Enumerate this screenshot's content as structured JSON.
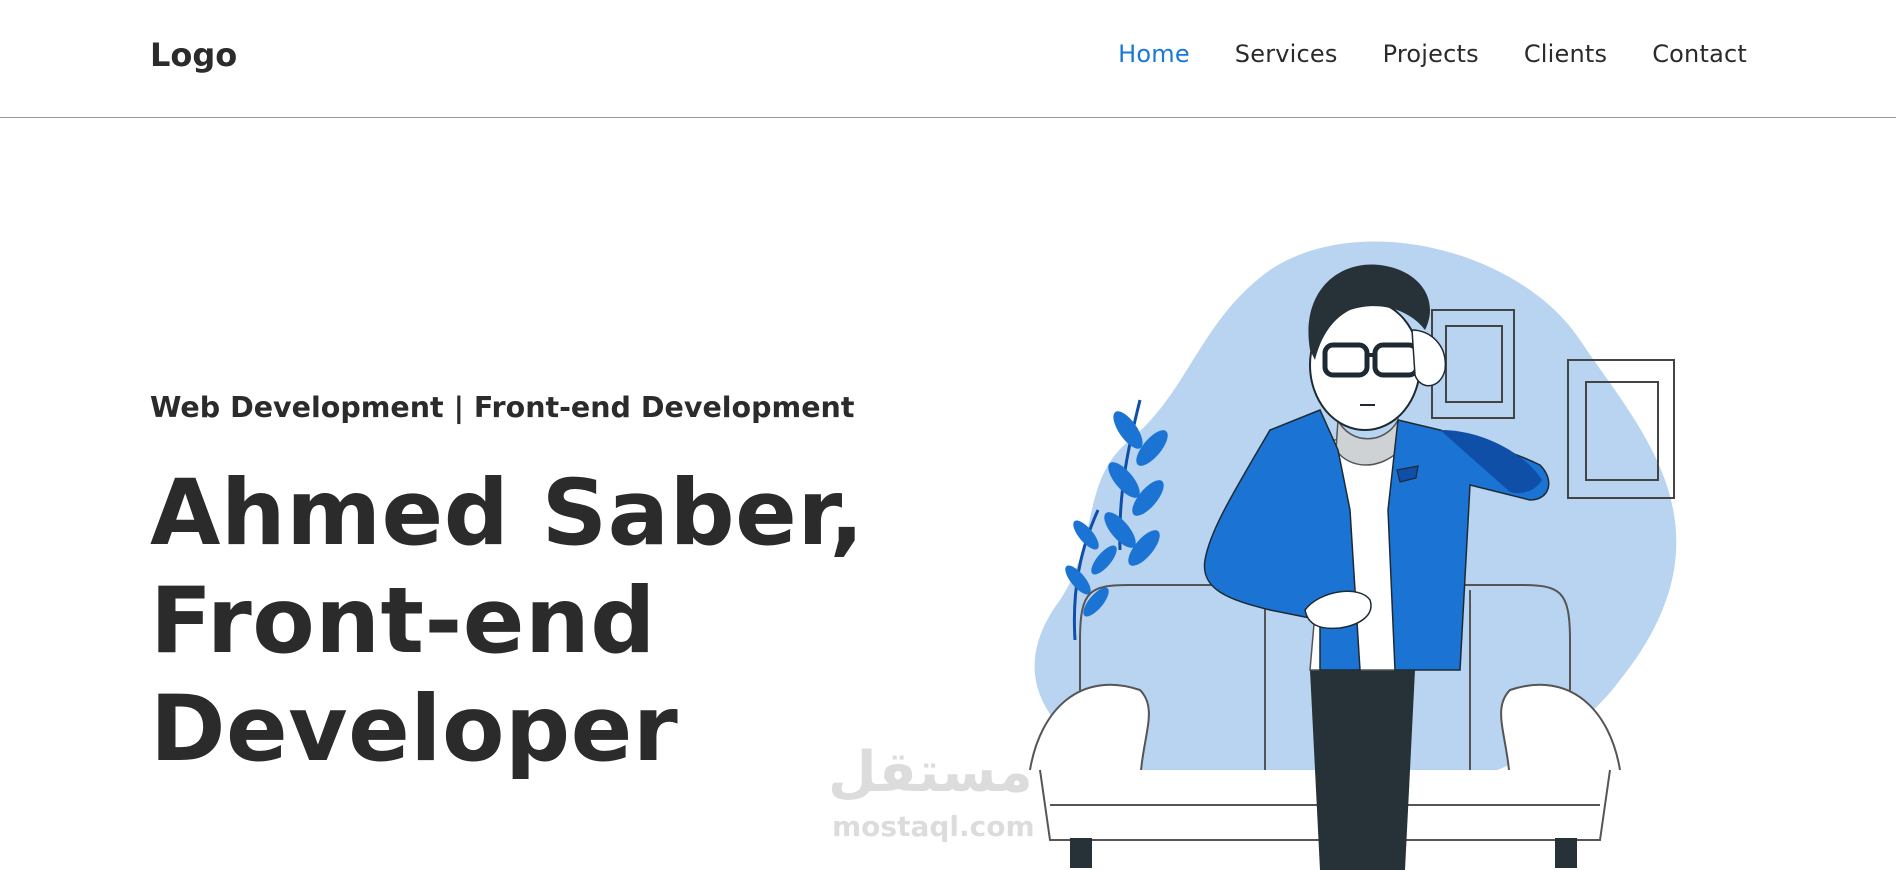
{
  "nav": {
    "logo": "Logo",
    "links": [
      {
        "label": "Home",
        "active": true
      },
      {
        "label": "Services",
        "active": false
      },
      {
        "label": "Projects",
        "active": false
      },
      {
        "label": "Clients",
        "active": false
      },
      {
        "label": "Contact",
        "active": false
      }
    ]
  },
  "hero": {
    "subtitle": "Web Development | Front-end Development",
    "headline_lines": [
      "Ahmed Saber,",
      "Front-end",
      "Developer"
    ]
  },
  "watermark": {
    "arabic": "مستقل",
    "latin": "mostaql.com"
  },
  "colors": {
    "accent": "#1a78d8",
    "text": "#2b2b2b",
    "blob": "#b8d4f1",
    "jacket": "#1b74d4",
    "jacket_dark": "#0f4fa8",
    "hair": "#263238"
  }
}
